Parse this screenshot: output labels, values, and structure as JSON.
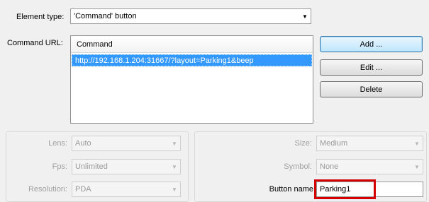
{
  "element_type": {
    "label": "Element type:",
    "value": "'Command' button"
  },
  "command_url": {
    "label": "Command URL:",
    "column_header": "Command",
    "rows": [
      "http://192.168.1.204:31667/?layout=Parking1&beep"
    ]
  },
  "buttons": {
    "add": "Add ...",
    "edit": "Edit ...",
    "delete": "Delete"
  },
  "left_fields": {
    "lens": {
      "label": "Lens:",
      "value": "Auto"
    },
    "fps": {
      "label": "Fps:",
      "value": "Unlimited"
    },
    "resolution": {
      "label": "Resolution:",
      "value": "PDA"
    }
  },
  "right_fields": {
    "size": {
      "label": "Size:",
      "value": "Medium"
    },
    "symbol": {
      "label": "Symbol:",
      "value": "None"
    },
    "button_name": {
      "label": "Button name",
      "value": "Parking1"
    }
  },
  "colors": {
    "selection": "#3399ff",
    "highlight_box": "#d40000"
  }
}
